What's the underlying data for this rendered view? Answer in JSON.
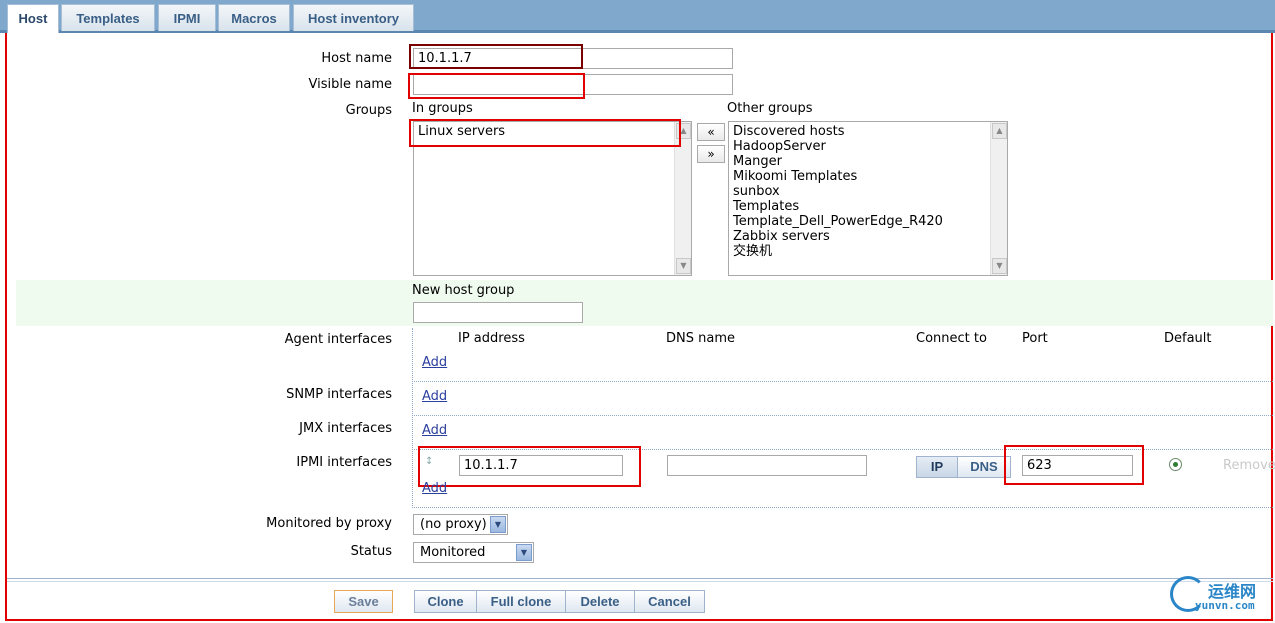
{
  "tabs": [
    "Host",
    "Templates",
    "IPMI",
    "Macros",
    "Host inventory"
  ],
  "labels": {
    "host_name": "Host name",
    "visible_name": "Visible name",
    "groups": "Groups",
    "in_groups": "In groups",
    "other_groups": "Other groups",
    "new_host_group": "New host group",
    "agent_interfaces": "Agent interfaces",
    "snmp_interfaces": "SNMP interfaces",
    "jmx_interfaces": "JMX interfaces",
    "ipmi_interfaces": "IPMI interfaces",
    "monitored_by_proxy": "Monitored by proxy",
    "status": "Status"
  },
  "fields": {
    "host_name": "10.1.1.7",
    "visible_name": "",
    "new_host_group": ""
  },
  "in_groups": [
    "Linux servers"
  ],
  "other_groups": [
    "Discovered hosts",
    "HadoopServer",
    "Manger",
    "Mikoomi Templates",
    "sunbox",
    "Templates",
    "Template_Dell_PowerEdge_R420",
    "Zabbix servers",
    "交换机"
  ],
  "move_left": "«",
  "move_right": "»",
  "interfaces": {
    "headers": {
      "ip_address": "IP address",
      "dns_name": "DNS name",
      "connect_to": "Connect to",
      "port": "Port",
      "default": "Default"
    },
    "add": "Add",
    "ipmi": {
      "ip": "10.1.1.7",
      "dns": "",
      "connect_ip": "IP",
      "connect_dns": "DNS",
      "port": "623",
      "remove": "Remove"
    }
  },
  "proxy": "(no proxy)",
  "status": "Monitored",
  "buttons": {
    "save": "Save",
    "clone": "Clone",
    "full_clone": "Full clone",
    "delete": "Delete",
    "cancel": "Cancel"
  },
  "watermark": {
    "cn": "运维网",
    "site": "yunvn.com"
  },
  "colors": {
    "annotation_red": "#e00000",
    "tab_blue": "#7fa8cc",
    "highlight_green": "#f0fbef"
  }
}
